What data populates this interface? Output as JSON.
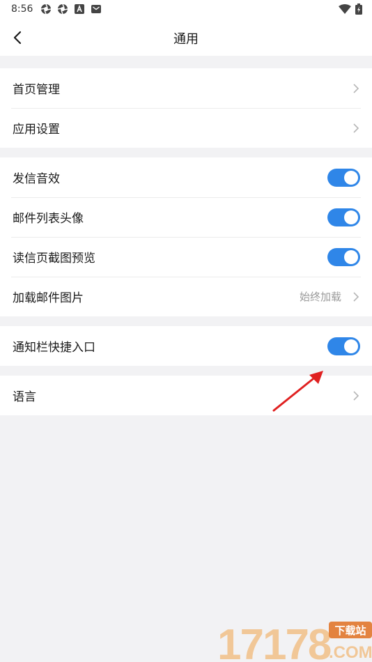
{
  "status_bar": {
    "time": "8:56",
    "icons_left": [
      "aperture-icon",
      "aperture-icon",
      "font-app-icon",
      "mail-notification-icon"
    ],
    "icons_right": [
      "wifi-icon",
      "battery-charging-icon"
    ]
  },
  "header": {
    "title": "通用",
    "back_icon": "back-chevron-icon"
  },
  "groups": [
    {
      "rows": [
        {
          "label": "首页管理",
          "control": "chevron"
        },
        {
          "label": "应用设置",
          "control": "chevron"
        }
      ]
    },
    {
      "rows": [
        {
          "label": "发信音效",
          "control": "toggle",
          "on": true
        },
        {
          "label": "邮件列表头像",
          "control": "toggle",
          "on": true
        },
        {
          "label": "读信页截图预览",
          "control": "toggle",
          "on": true
        },
        {
          "label": "加载邮件图片",
          "control": "chevron",
          "value": "始终加载"
        }
      ]
    },
    {
      "rows": [
        {
          "label": "通知栏快捷入口",
          "control": "toggle",
          "on": true
        }
      ]
    },
    {
      "rows": [
        {
          "label": "语言",
          "control": "chevron"
        }
      ]
    }
  ],
  "colors": {
    "accent": "#2f86e8",
    "background": "#f2f2f4",
    "annotation_arrow": "#e02020"
  },
  "watermark": {
    "digits": "17178",
    "suffix": ".COM",
    "badge": "下载站"
  }
}
